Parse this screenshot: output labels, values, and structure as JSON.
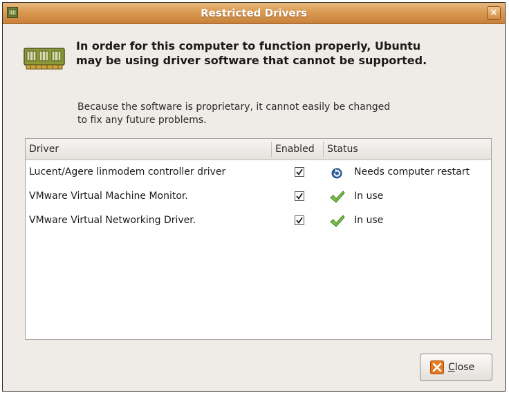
{
  "window": {
    "title": "Restricted Drivers",
    "close_glyph": "×"
  },
  "message": {
    "primary": "In order for this computer to function properly, Ubuntu may be using driver software that cannot be supported.",
    "secondary": "Because the software is proprietary, it cannot easily be changed to fix any future problems."
  },
  "table": {
    "columns": [
      "Driver",
      "Enabled",
      "Status"
    ],
    "rows": [
      {
        "driver": "Lucent/Agere linmodem controller driver",
        "enabled": true,
        "status": "Needs computer restart",
        "status_icon": "restart-icon"
      },
      {
        "driver": "VMware Virtual Machine Monitor.",
        "enabled": true,
        "status": "In use",
        "status_icon": "checkmark-icon"
      },
      {
        "driver": "VMware Virtual Networking Driver.",
        "enabled": true,
        "status": "In use",
        "status_icon": "checkmark-icon"
      }
    ]
  },
  "buttons": {
    "close_label": "Close"
  },
  "colors": {
    "titlebar": "#d99a52",
    "window_bg": "#efebe7",
    "check_green": "#5bb02b",
    "restart_blue": "#3465a4",
    "close_orange": "#e8781e"
  }
}
